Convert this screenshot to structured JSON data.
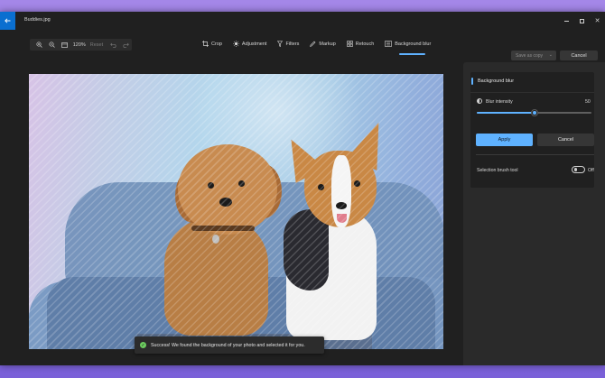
{
  "window": {
    "title": "Buddies.jpg",
    "back_icon": "arrow-left-icon",
    "controls": [
      "minimize-icon",
      "maximize-icon",
      "close-icon"
    ]
  },
  "zoom": {
    "zoom_in_icon": "zoom-in-icon",
    "zoom_out_icon": "zoom-out-icon",
    "fit_icon": "fit-to-window-icon",
    "value": "120%",
    "reset_label": "Reset",
    "undo_icon": "undo-icon",
    "redo_icon": "redo-icon"
  },
  "tools": [
    {
      "label": "Crop",
      "icon": "crop-icon"
    },
    {
      "label": "Adjustment",
      "icon": "adjustment-icon"
    },
    {
      "label": "Filters",
      "icon": "filters-icon"
    },
    {
      "label": "Markup",
      "icon": "markup-icon"
    },
    {
      "label": "Retouch",
      "icon": "retouch-icon"
    },
    {
      "label": "Background blur",
      "icon": "background-blur-icon",
      "active": true
    }
  ],
  "actions": {
    "save_label": "Save as copy",
    "cancel_label": "Cancel"
  },
  "toast": {
    "message": "Success! We found the background of your photo and selected it for you."
  },
  "panel": {
    "title": "Background blur",
    "intensity_label": "Blur intensity",
    "intensity_value": "50",
    "intensity_fraction": 0.5,
    "apply_label": "Apply",
    "cancel_label": "Cancel",
    "brush_label": "Selection brush tool",
    "brush_state": "Off"
  },
  "colors": {
    "accent": "#5fb2ff",
    "titlebar_button": "#0a6fd0",
    "success": "#6ccb5f"
  }
}
